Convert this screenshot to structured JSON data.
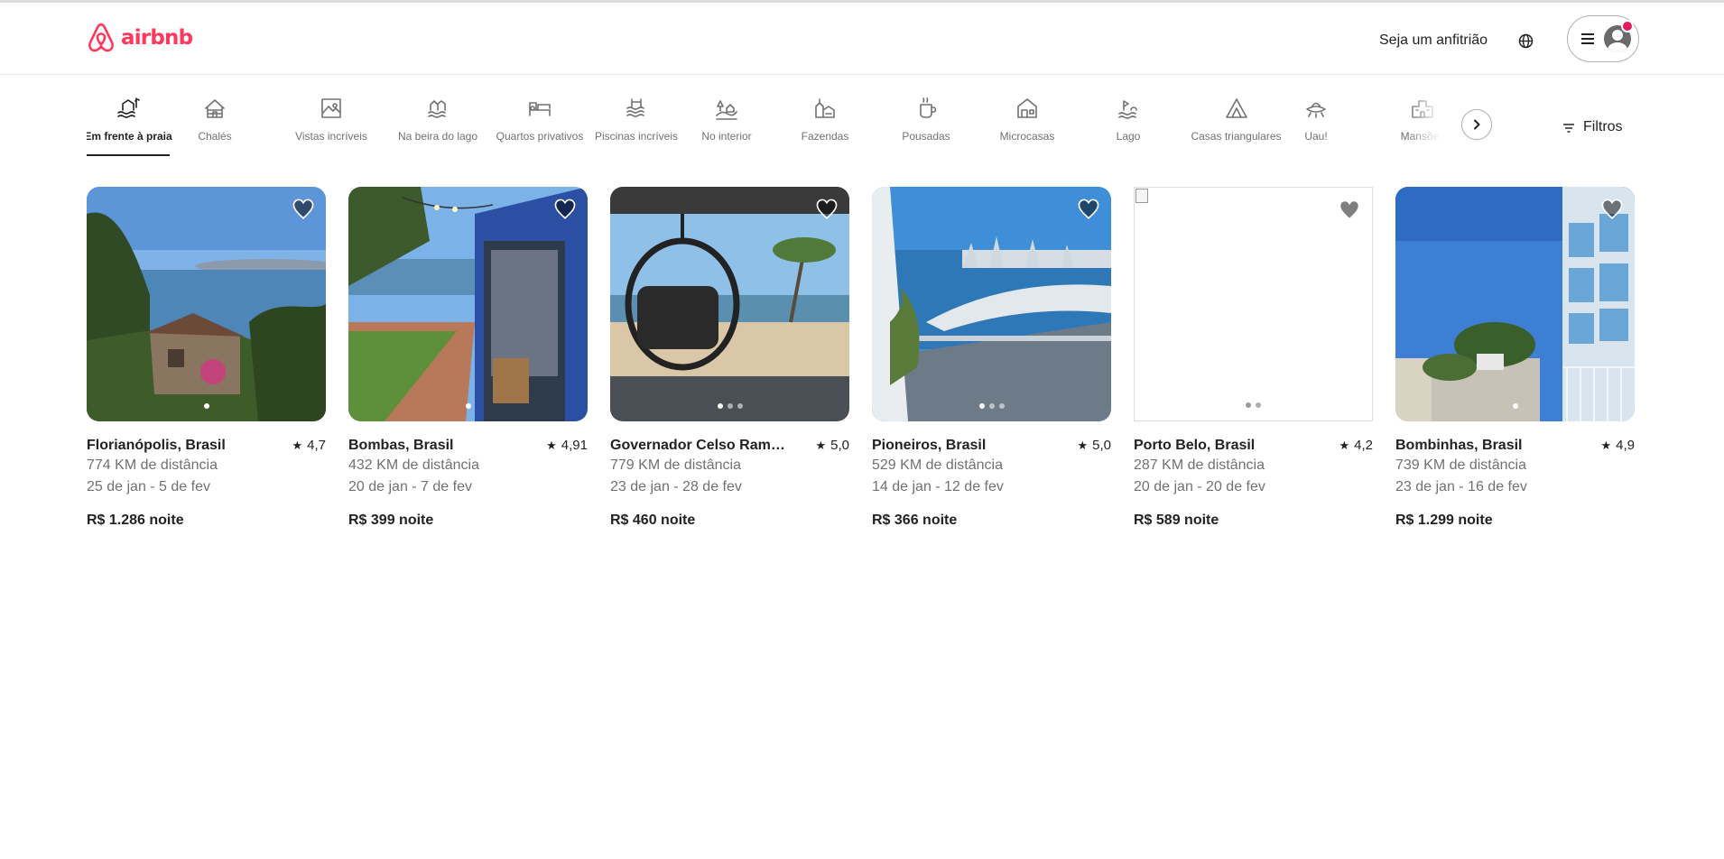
{
  "app": {
    "logo_text": "airbnb",
    "brand_color": "#ff385c"
  },
  "header": {
    "host_link": "Seja um anfitrião",
    "globe_icon": "globe-icon",
    "menu_icon": "hamburger-icon",
    "avatar_icon": "user-avatar-icon",
    "has_notification": true
  },
  "categories": [
    {
      "label": "Em frente à praia",
      "icon": "beachfront-icon",
      "active": true
    },
    {
      "label": "Chalés",
      "icon": "cabin-icon",
      "active": false
    },
    {
      "label": "Vistas incríveis",
      "icon": "amazing-views-icon",
      "active": false
    },
    {
      "label": "Na beira do lago",
      "icon": "lakefront-icon",
      "active": false
    },
    {
      "label": "Quartos privativos",
      "icon": "private-room-icon",
      "active": false
    },
    {
      "label": "Piscinas incríveis",
      "icon": "amazing-pools-icon",
      "active": false
    },
    {
      "label": "No interior",
      "icon": "countryside-icon",
      "active": false
    },
    {
      "label": "Fazendas",
      "icon": "farm-icon",
      "active": false
    },
    {
      "label": "Pousadas",
      "icon": "bed-and-breakfast-icon",
      "active": false
    },
    {
      "label": "Microcasas",
      "icon": "tiny-home-icon",
      "active": false
    },
    {
      "label": "Lago",
      "icon": "lake-icon",
      "active": false
    },
    {
      "label": "Casas triangulares",
      "icon": "a-frame-icon",
      "active": false
    },
    {
      "label": "Uau!",
      "icon": "omg-ufo-icon",
      "active": false
    },
    {
      "label": "Mansões",
      "icon": "mansion-icon",
      "active": false
    }
  ],
  "filters": {
    "label": "Filtros",
    "icon": "filter-sliders-icon"
  },
  "listings": [
    {
      "title": "Florianópolis, Brasil",
      "rating": "4,7",
      "distance": "774 KM de distância",
      "dates": "25 de jan - 5 de fev",
      "price": "R$ 1.286 noite",
      "photos": 1,
      "active_photo": 0,
      "image_loaded": true,
      "scene": "hillside-house-bay"
    },
    {
      "title": "Bombas, Brasil",
      "rating": "4,91",
      "distance": "432 KM de distância",
      "dates": "20 de jan - 7 de fev",
      "price": "R$ 399 noite",
      "photos": 1,
      "active_photo": 0,
      "image_loaded": true,
      "scene": "blue-container-deck"
    },
    {
      "title": "Governador Celso Ramos, Brasil",
      "title_shown": "Governador Celso Ramo...",
      "rating": "5,0",
      "distance": "779 KM de distância",
      "dates": "23 de jan - 28 de fev",
      "price": "R$ 460 noite",
      "photos": 3,
      "active_photo": 0,
      "image_loaded": true,
      "scene": "hanging-chair-beach"
    },
    {
      "title": "Pioneiros, Brasil",
      "rating": "5,0",
      "distance": "529 KM de distância",
      "dates": "14 de jan - 12 de fev",
      "price": "R$ 366 noite",
      "photos": 3,
      "active_photo": 0,
      "image_loaded": true,
      "scene": "balcony-city-sea"
    },
    {
      "title": "Porto Belo, Brasil",
      "rating": "4,2",
      "distance": "287 KM de distância",
      "dates": "20 de jan - 20 de fev",
      "price": "R$ 589 noite",
      "photos": 2,
      "active_photo": 0,
      "image_loaded": false,
      "scene": "broken-image"
    },
    {
      "title": "Bombinhas, Brasil",
      "rating": "4,9",
      "distance": "739 KM de distância",
      "dates": "23 de jan - 16 de fev",
      "price": "R$ 1.299 noite",
      "photos": 1,
      "active_photo": 0,
      "image_loaded": true,
      "scene": "glass-building-beach-path"
    }
  ],
  "colors": {
    "text": "#222222",
    "muted": "#717171",
    "border": "#dddddd",
    "notification": "#e31c5f"
  }
}
